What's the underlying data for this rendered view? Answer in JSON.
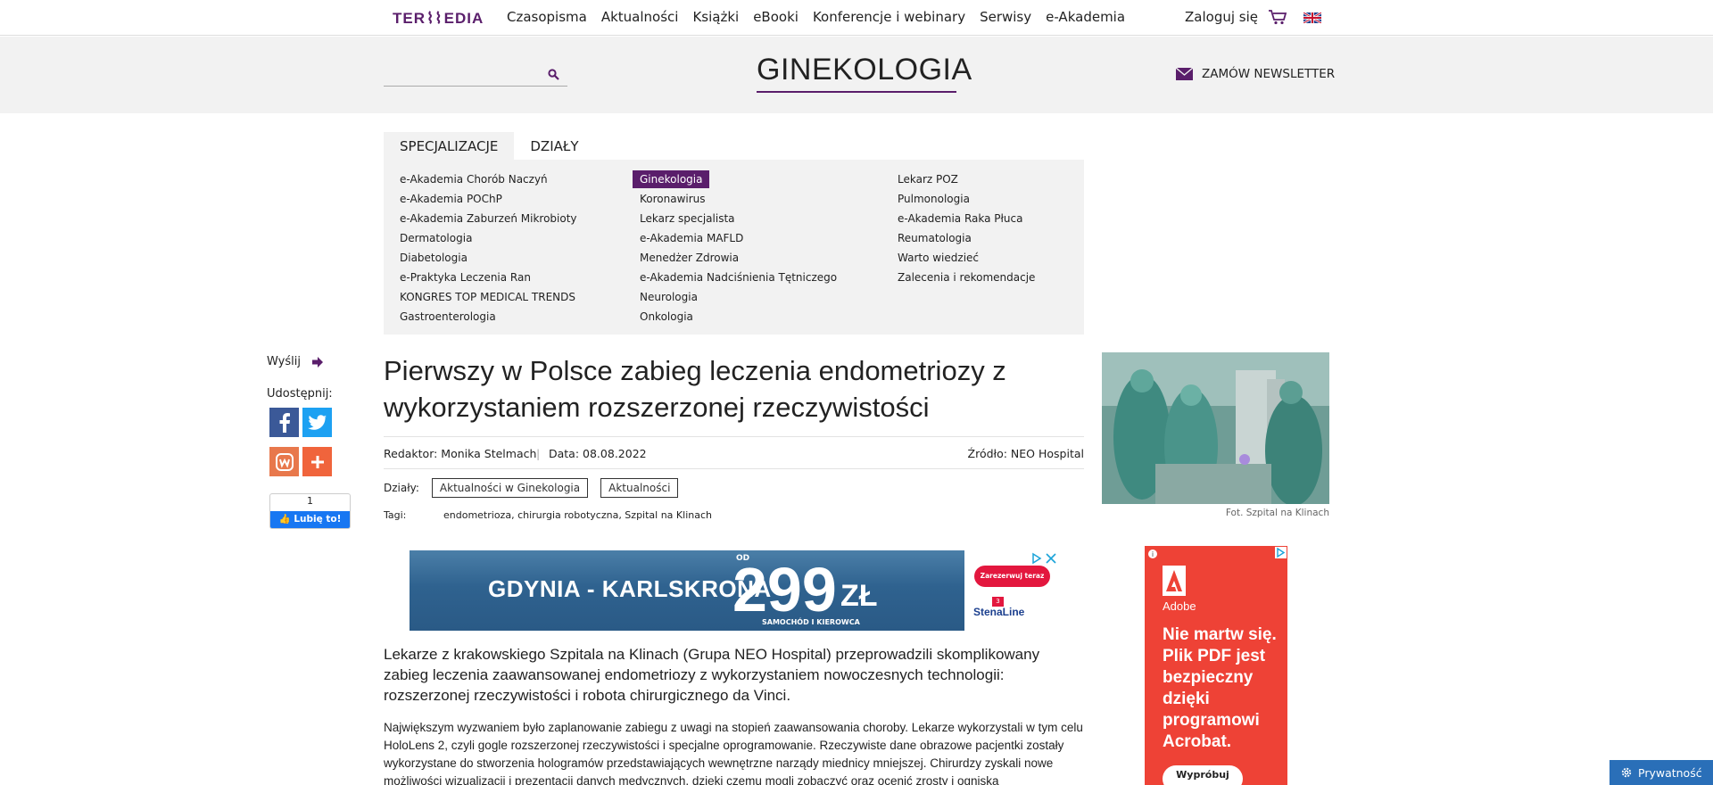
{
  "topnav": {
    "logo_text": "TERMEDIA",
    "menu": [
      "Czasopisma",
      "Aktualności",
      "Książki",
      "eBooki",
      "Konferencje i webinary",
      "Serwisy",
      "e-Akademia"
    ],
    "login": "Zaloguj się",
    "cart_icon": "cart-icon",
    "flag_icon": "uk-flag-icon"
  },
  "header": {
    "search_placeholder": "",
    "section_title": "GINEKOLOGIA",
    "newsletter": "ZAMÓW NEWSLETTER"
  },
  "tabs": [
    "SPECJALIZACJE",
    "DZIAŁY"
  ],
  "specializations": {
    "col1": [
      "e-Akademia Chorób Naczyń",
      "e-Akademia POChP",
      "e-Akademia Zaburzeń Mikrobioty",
      "Dermatologia",
      "Diabetologia",
      "e-Praktyka Leczenia Ran",
      "KONGRES TOP MEDICAL TRENDS",
      "Gastroenterologia"
    ],
    "col2": [
      "Ginekologia",
      "Koronawirus",
      "Lekarz specjalista",
      "e-Akademia MAFLD",
      "Menedżer Zdrowia",
      "e-Akademia Nadciśnienia Tętniczego",
      "Neurologia",
      "Onkologia"
    ],
    "col3": [
      "Lekarz POZ",
      "Pulmonologia",
      "e-Akademia Raka Płuca",
      "Reumatologia",
      "Warto wiedzieć",
      "Zalecenia i rekomendacje"
    ],
    "active": "Ginekologia"
  },
  "share": {
    "send": "Wyślij",
    "share_label": "Udostępnij:",
    "like_count": "1",
    "like_label": "Lubię to!"
  },
  "article": {
    "title": "Pierwszy w Polsce zabieg leczenia endometriozy z wykorzystaniem rozszerzonej rzeczywistości",
    "editor": "Redaktor: Monika Stelmach",
    "separator": "|",
    "date": "Data: 08.08.2022",
    "source": "Źródło: NEO Hospital",
    "departments_label": "Działy:",
    "departments": [
      "Aktualności w Ginekologia",
      "Aktualności"
    ],
    "tags_label": "Tagi:",
    "tags": "endometrioza, chirurgia robotyczna, Szpital na Klinach",
    "lead": "Lekarze z krakowskiego Szpitala na Klinach (Grupa NEO Hospital) przeprowadzili skomplikowany zabieg leczenia zaawansowanej endometriozy z wykorzystaniem nowoczesnych technologii: rozszerzonej rzeczywistości i robota chirurgicznego da Vinci.",
    "para1": "Największym wyzwaniem było zaplanowanie zabiegu z uwagi na stopień zaawansowania choroby. Lekarze wykorzystali w tym celu HoloLens 2, czyli gogle rozszerzonej rzeczywistości i specjalne oprogramowanie. Rzeczywiste dane obrazowe pacjentki zostały wykorzystane do stworzenia hologramów przedstawiających wewnętrzne narządy miednicy mniejszej. Chirurdzy zyskali nowe możliwości wizualizacji i prezentacji danych medycznych, dzięki czemu mogli zobaczyć oraz ocenić zrosty i ogniska",
    "photo_caption": "Fot. Szpital na Klinach"
  },
  "ad_banner": {
    "route": "GDYNIA - KARLSKRONA",
    "od": "OD",
    "price": "299",
    "currency": "ZŁ",
    "note": "SAMOCHÓD I KIEROWCA",
    "cta": "Zarezerwuj teraz",
    "brand": "StenaLine",
    "badge": "3"
  },
  "side_ad": {
    "brand": "Adobe",
    "text": "Nie martw się. Plik PDF jest bezpieczny dzięki programowi Acrobat.",
    "cta": "Wypróbuj bezpłatnie"
  },
  "privacy": "Prywatność",
  "colors": {
    "brand_purple": "#5a1e6b",
    "band_gray": "#f2f2f2",
    "facebook": "#3b5998",
    "twitter": "#1da1f2",
    "adobe_red": "#ee4236"
  }
}
